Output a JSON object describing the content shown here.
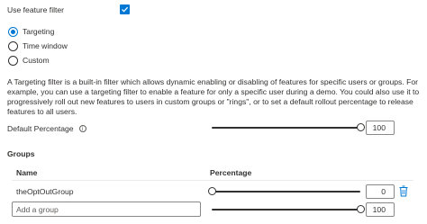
{
  "feature_filter": {
    "label": "Use feature filter",
    "checked": true
  },
  "filter_type": {
    "options": [
      "Targeting",
      "Time window",
      "Custom"
    ],
    "selected": "Targeting"
  },
  "description": "A Targeting filter is a built-in filter which allows dynamic enabling or disabling of features for specific users or groups. For example, you can use a targeting filter to enable a feature for only a specific user during a demo. You could also use it to progressively roll out new features to users in custom groups or \"rings\", or to set a default rollout percentage to release features to all users.",
  "default_percentage": {
    "label": "Default Percentage",
    "value": "100",
    "fraction": 1.0
  },
  "groups": {
    "title": "Groups",
    "col_name": "Name",
    "col_percentage": "Percentage",
    "rows": [
      {
        "name": "theOptOutGroup",
        "value": "0",
        "fraction": 0.0
      }
    ],
    "new_row": {
      "placeholder": "Add a group",
      "value": "100",
      "fraction": 1.0
    }
  },
  "colors": {
    "accent": "#0078d4",
    "text": "#323130",
    "delete_icon": "#0078d4"
  },
  "icons": [
    "checkmark-icon",
    "info-icon",
    "trash-icon"
  ]
}
